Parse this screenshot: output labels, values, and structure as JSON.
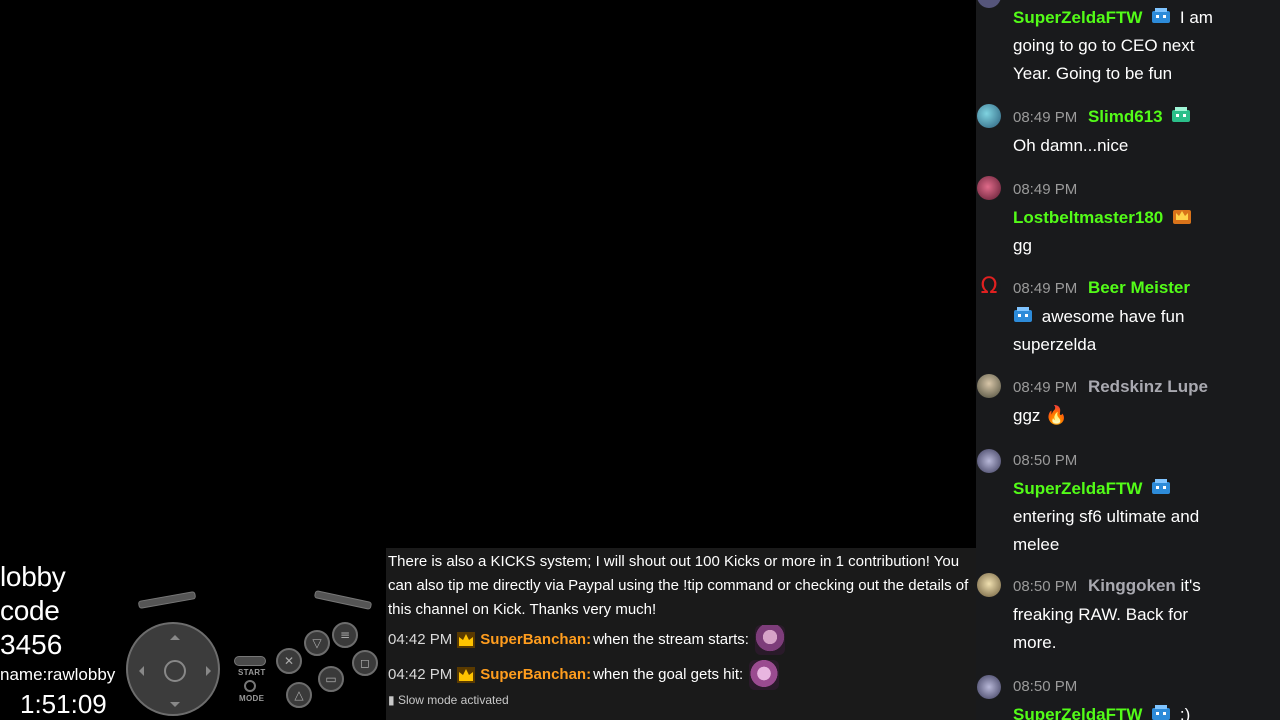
{
  "stream": {
    "lobby_line1": "lobby code",
    "lobby_line2": "3456",
    "lobby_line3": "name:rawlobby",
    "timer": "1:51:09",
    "controller_start_label": "START",
    "controller_mode_label": "MODE"
  },
  "overlay_chat": {
    "info_text": "There is also a KICKS system; I will shout out 100 Kicks or more in 1 contribution! You can also tip me directly via Paypal using the !tip command or checking out the details of this channel on Kick. Thanks very much!",
    "messages": [
      {
        "time": "04:42 PM",
        "user": "SuperBanchan",
        "text": "when the stream starts:"
      },
      {
        "time": "04:42 PM",
        "user": "SuperBanchan",
        "text": "when the goal gets hit:"
      }
    ],
    "status": "Slow mode activated"
  },
  "chat": {
    "messages": [
      {
        "time": "",
        "user": "SuperZeldaFTW",
        "text": "I am going to go to CEO next Year. Going to be fun"
      },
      {
        "time": "08:49 PM",
        "user": "Slimd613",
        "text": "Oh damn...nice"
      },
      {
        "time": "08:49 PM",
        "user": "Lostbeltmaster180",
        "text": "gg"
      },
      {
        "time": "08:49 PM",
        "user": "Beer Meister",
        "text": "awesome have fun superzelda"
      },
      {
        "time": "08:49 PM",
        "user": "Redskinz Lupe",
        "text": "ggz"
      },
      {
        "time": "08:50 PM",
        "user": "SuperZeldaFTW",
        "text": "entering sf6 ultimate and melee"
      },
      {
        "time": "08:50 PM",
        "user": "Kinggoken",
        "text": "it's freaking RAW. Back for more."
      },
      {
        "time": "08:50 PM",
        "user": "SuperZeldaFTW",
        "text": ":)"
      }
    ]
  },
  "colors": {
    "username_green": "#53fc18",
    "username_grey": "#a9a9b0",
    "username_orange": "#ff9d1e",
    "chat_bg": "#191a1c"
  }
}
